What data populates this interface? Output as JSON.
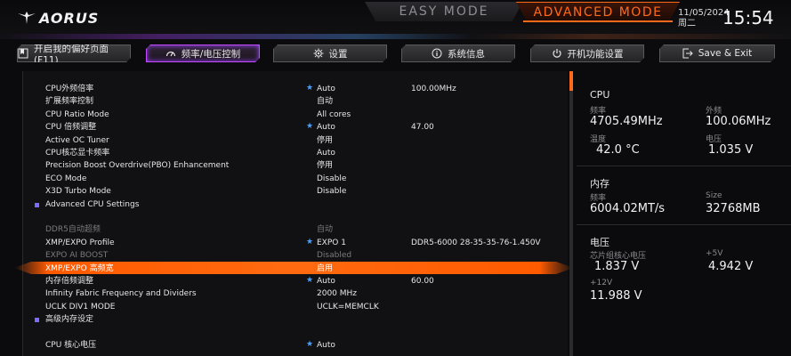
{
  "header": {
    "brand": "AORUS",
    "easy_mode": "EASY MODE",
    "advanced_mode": "ADVANCED MODE",
    "date": "11/05/2024",
    "weekday": "周二",
    "time": "15:54"
  },
  "tabs": [
    {
      "label": "开启我的偏好页面 (F11)",
      "icon": "bookmark-icon"
    },
    {
      "label": "频率/电压控制",
      "icon": "gauge-icon"
    },
    {
      "label": "设置",
      "icon": "gear-icon"
    },
    {
      "label": "系统信息",
      "icon": "info-icon"
    },
    {
      "label": "开机功能设置",
      "icon": "power-icon"
    },
    {
      "label": "Save & Exit",
      "icon": "exit-icon"
    }
  ],
  "settings": [
    {
      "label": "CPU外频倍率",
      "value": "Auto",
      "current": "100.00MHz",
      "star": true
    },
    {
      "label": "扩展频率控制",
      "value": "自动",
      "current": ""
    },
    {
      "label": "CPU Ratio Mode",
      "value": "All cores",
      "current": ""
    },
    {
      "label": "CPU 倍频调整",
      "value": "Auto",
      "current": "47.00",
      "star": true
    },
    {
      "label": "Active OC Tuner",
      "value": "停用",
      "current": ""
    },
    {
      "label": "CPU核芯显卡频率",
      "value": "Auto",
      "current": ""
    },
    {
      "label": "Precision Boost Overdrive(PBO) Enhancement",
      "value": "停用",
      "current": ""
    },
    {
      "label": "ECO Mode",
      "value": "Disable",
      "current": ""
    },
    {
      "label": "X3D Turbo Mode",
      "value": "Disable",
      "current": ""
    },
    {
      "label": "Advanced CPU Settings",
      "value": "",
      "current": "",
      "submenu": true
    },
    {
      "label": "",
      "value": "",
      "current": ""
    },
    {
      "label": "DDR5自动超频",
      "value": "自动",
      "current": "",
      "dim": true
    },
    {
      "label": "XMP/EXPO Profile",
      "value": "EXPO 1",
      "current": "DDR5-6000 28-35-35-76-1.450V",
      "star": true
    },
    {
      "label": "EXPO AI BOOST",
      "value": "Disabled",
      "current": "",
      "dim": true
    },
    {
      "label": "XMP/EXPO 高频宽",
      "value": "启用",
      "current": "",
      "highlight": true
    },
    {
      "label": "内存倍频调整",
      "value": "Auto",
      "current": "60.00",
      "star": true
    },
    {
      "label": "Infinity Fabric Frequency and Dividers",
      "value": "2000 MHz",
      "current": ""
    },
    {
      "label": "UCLK DIV1 MODE",
      "value": "UCLK=MEMCLK",
      "current": ""
    },
    {
      "label": "高级内存设定",
      "value": "",
      "current": "",
      "submenu": true
    },
    {
      "label": "",
      "value": "",
      "current": ""
    },
    {
      "label": "CPU 核心电压",
      "value": "Auto",
      "current": "",
      "star": true
    }
  ],
  "monitor": {
    "cpu": {
      "title": "CPU",
      "freq_label": "频率",
      "freq": "4705.49MHz",
      "bclk_label": "外频",
      "bclk": "100.06MHz",
      "temp_label": "温度",
      "temp": "42.0 °C",
      "volt_label": "电压",
      "volt": "1.035 V"
    },
    "memory": {
      "title": "内存",
      "freq_label": "频率",
      "freq": "6004.02MT/s",
      "size_label": "Size",
      "size": "32768MB"
    },
    "voltage": {
      "title": "电压",
      "chipset_label": "芯片组核心电压",
      "chipset": "1.837 V",
      "p5v_label": "+5V",
      "p5v": "4.942 V",
      "p12v_label": "+12V",
      "p12v": "11.988 V"
    }
  },
  "colors": {
    "accent_orange": "#ff6a1a",
    "accent_purple": "#c04bff",
    "star_blue": "#4aa0ff"
  }
}
